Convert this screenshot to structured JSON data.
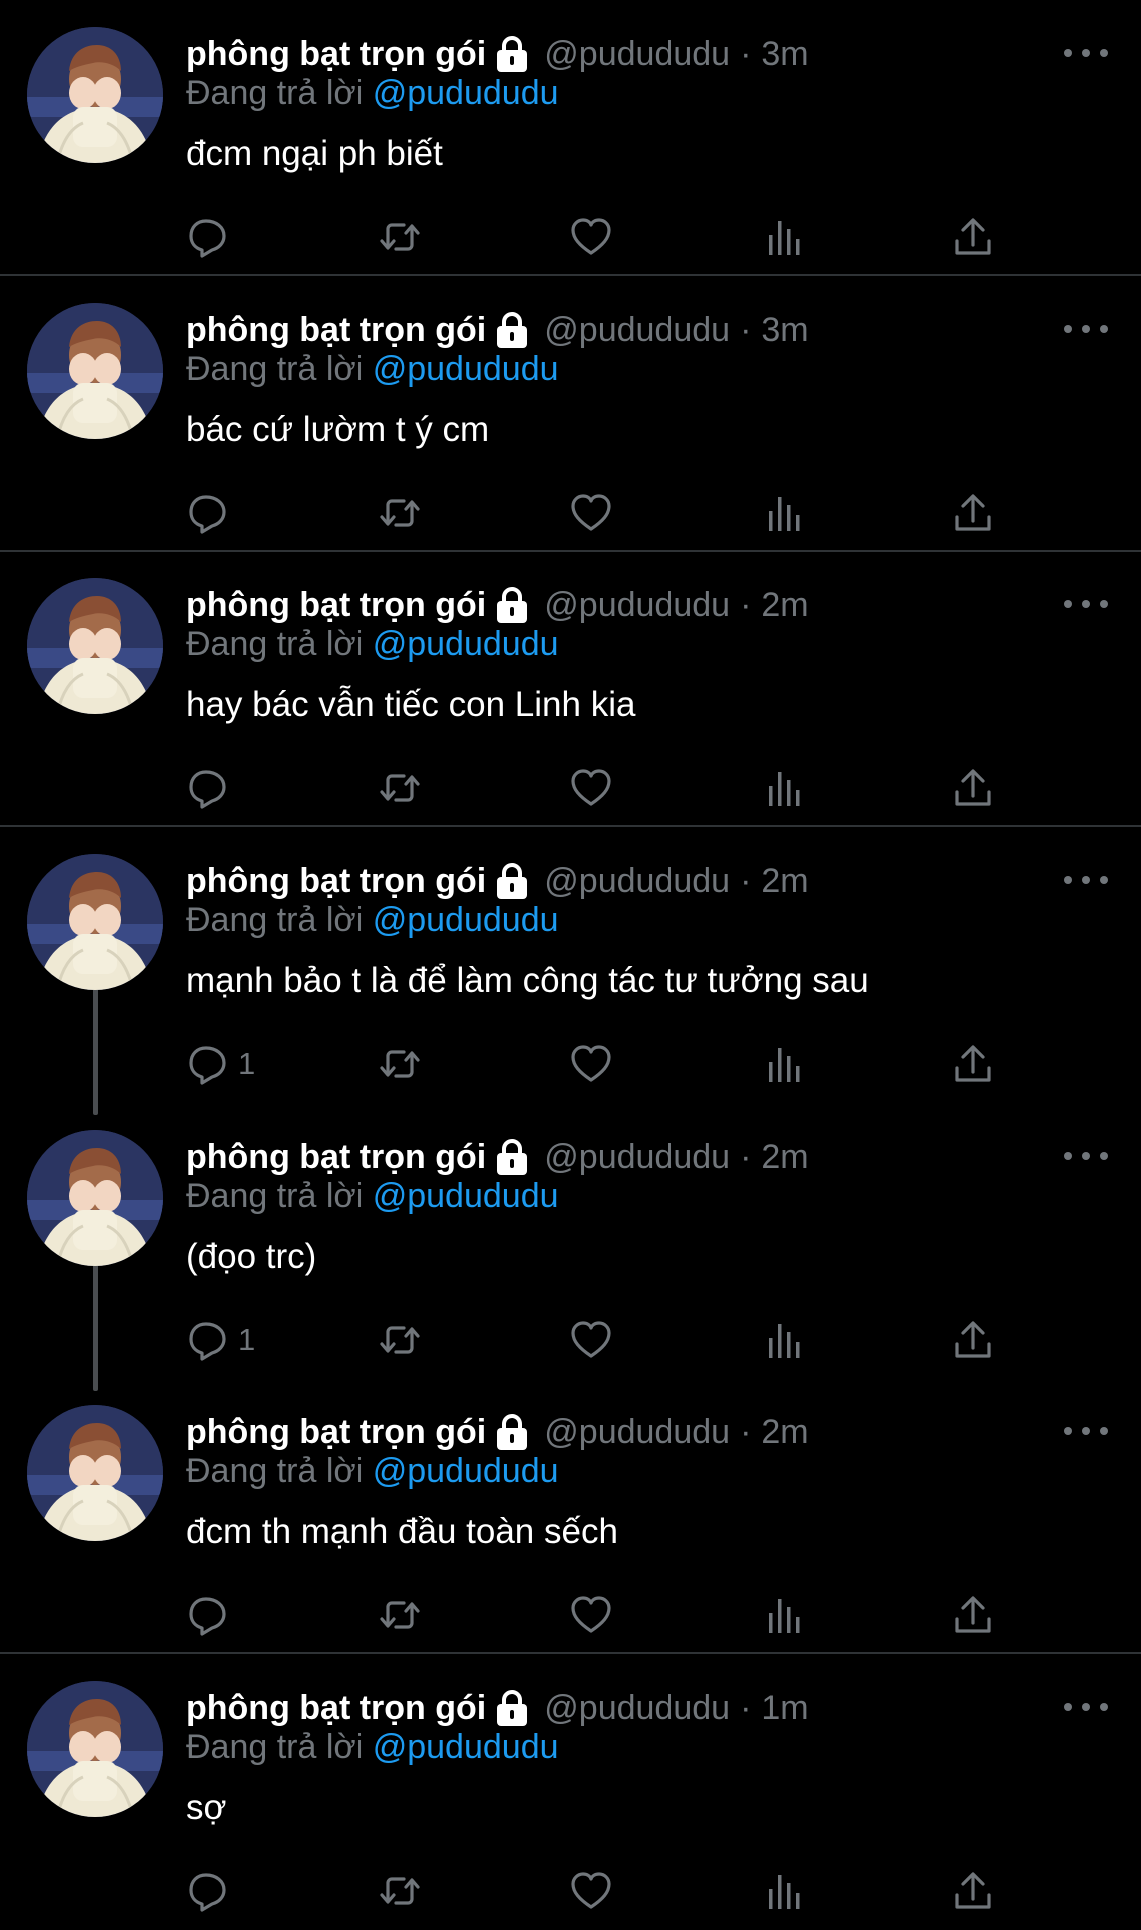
{
  "author": {
    "display_name": "phông bạt trọn gói",
    "handle": "@pudududu",
    "protected_icon": "lock-icon",
    "avatar_icon": "avatar-photo"
  },
  "reply_prefix": "Đang trả lời",
  "reply_to": "@pudududu",
  "separator": "·",
  "icons": {
    "reply": "reply-icon",
    "retweet": "retweet-icon",
    "like": "heart-icon",
    "views": "analytics-icon",
    "share": "share-icon",
    "more": "more-icon"
  },
  "colors": {
    "background": "#000000",
    "text": "#ffffff",
    "muted": "#71767b",
    "link": "#1d9bf0",
    "divider": "#2f3336"
  },
  "tweets": [
    {
      "time": "3m",
      "text": "đcm ngại ph biết",
      "reply_count": ""
    },
    {
      "time": "3m",
      "text": "bác cứ lườm t ý cm",
      "reply_count": ""
    },
    {
      "time": "2m",
      "text": "hay bác vẫn tiếc con Linh kia",
      "reply_count": ""
    },
    {
      "time": "2m",
      "text": "mạnh bảo t là để làm công tác tư tưởng sau",
      "reply_count": "1"
    },
    {
      "time": "2m",
      "text": "(đọo trc)",
      "reply_count": "1"
    },
    {
      "time": "2m",
      "text": "đcm th mạnh đầu toàn sếch",
      "reply_count": ""
    },
    {
      "time": "1m",
      "text": "sợ",
      "reply_count": ""
    }
  ]
}
